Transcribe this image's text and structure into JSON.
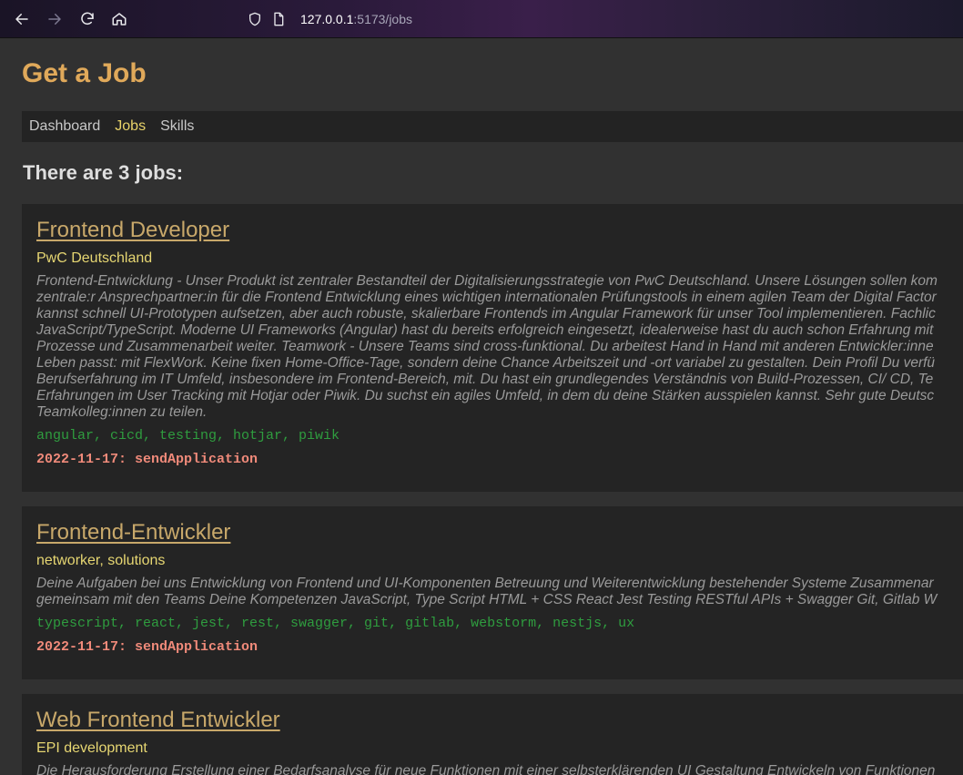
{
  "browser": {
    "url_host": "127.0.0.1",
    "url_rest": ":5173/jobs"
  },
  "app": {
    "title": "Get a Job"
  },
  "nav": {
    "items": [
      {
        "label": "Dashboard",
        "active": false
      },
      {
        "label": "Jobs",
        "active": true
      },
      {
        "label": "Skills",
        "active": false
      }
    ]
  },
  "jobs_heading": "There are 3 jobs:",
  "jobs": [
    {
      "title": "Frontend Developer",
      "company": "PwC Deutschland",
      "description_lines": [
        "Frontend-Entwicklung - Unser Produkt ist zentraler Bestandteil der Digitalisierungsstrategie von PwC Deutschland. Unsere Lösungen sollen kom",
        "zentrale:r Ansprechpartner:in für die Frontend Entwicklung eines wichtigen internationalen Prüfungstools in einem agilen Team der Digital Factor",
        "kannst schnell UI-Prototypen aufsetzen, aber auch robuste, skalierbare Frontends im Angular Framework für unser Tool implementieren. Fachlic",
        "JavaScript/TypeScript. Moderne UI Frameworks (Angular) hast du bereits erfolgreich eingesetzt, idealerweise hast du auch schon Erfahrung mit",
        "Prozesse und Zusammenarbeit weiter. Teamwork - Unsere Teams sind cross-funktional. Du arbeitest Hand in Hand mit anderen Entwickler:inne",
        "Leben passt: mit FlexWork. Keine fixen Home-Office-Tage, sondern deine Chance Arbeitszeit und -ort variabel zu gestalten. Dein Profil Du verfü",
        "Berufserfahrung im IT Umfeld, insbesondere im Frontend-Bereich, mit. Du hast ein grundlegendes Verständnis von Build-Prozessen, CI/ CD, Te",
        "Erfahrungen im User Tracking mit Hotjar oder Piwik. Du suchst ein agiles Umfeld, in dem du deine Stärken ausspielen kannst. Sehr gute Deutsc",
        "Teamkolleg:innen zu teilen."
      ],
      "skills": "angular, cicd, testing, hotjar, piwik",
      "status": "2022-11-17: sendApplication"
    },
    {
      "title": "Frontend-Entwickler",
      "company": "networker, solutions",
      "description_lines": [
        "Deine Aufgaben bei uns Entwicklung von Frontend und UI-Komponenten Betreuung und Weiterentwicklung bestehender Systeme Zusammenar",
        "gemeinsam mit den Teams Deine Kompetenzen JavaScript, Type Script HTML + CSS React Jest Testing RESTful APIs + Swagger Git, Gitlab W"
      ],
      "skills": "typescript, react, jest, rest, swagger, git, gitlab, webstorm, nestjs, ux",
      "status": "2022-11-17: sendApplication"
    },
    {
      "title": "Web Frontend Entwickler",
      "company": "EPI development",
      "description_lines": [
        "Die Herausforderung Erstellung einer Bedarfsanalyse für neue Funktionen mit einer selbsterklärenden UI Gestaltung Entwickeln von Funktionen"
      ],
      "skills": "",
      "status": ""
    }
  ]
}
